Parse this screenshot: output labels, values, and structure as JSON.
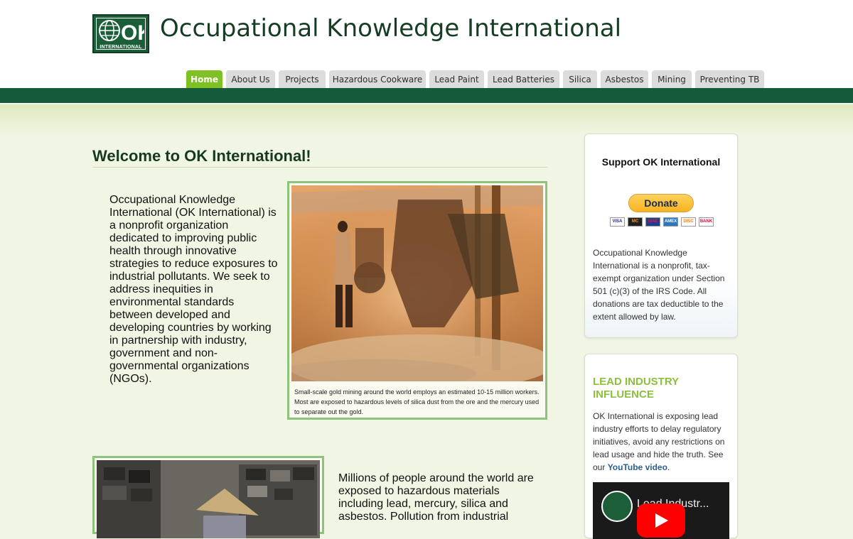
{
  "site": {
    "title": "Occupational Knowledge International",
    "logo_text": "INTERNATIONAL",
    "logo_letters": "OK"
  },
  "nav": {
    "tabs": [
      {
        "label": "Home",
        "active": true
      },
      {
        "label": "About Us"
      },
      {
        "label": "Projects"
      },
      {
        "label": "Hazardous Cookware"
      },
      {
        "label": "Lead Paint"
      },
      {
        "label": "Lead Batteries"
      },
      {
        "label": "Silica"
      },
      {
        "label": "Asbestos"
      },
      {
        "label": "Mining"
      },
      {
        "label": "Preventing TB"
      }
    ]
  },
  "main": {
    "heading": "Welcome to OK International!",
    "intro": "Occupational Knowledge International (OK International) is a nonprofit organization dedicated to improving public health through innovative strategies to reduce exposures to industrial pollutants. We seek to address inequities in environmental standards between developed and developing countries by working in partnership with industry, government and non-governmental organizations (NGOs).",
    "photo_caption": "Small-scale gold mining around the world employs an estimated 10-15 million workers. Most are exposed to hazardous levels of silica dust from the ore and the mercury used to separate out the gold.",
    "paragraph2": "Millions of people around the world are exposed to hazardous materials including lead, mercury, silica and asbestos. Pollution from industrial"
  },
  "sidebar": {
    "support": {
      "title": "Support OK International",
      "donate_label": "Donate",
      "cards": [
        "VISA",
        "MC",
        "MAE",
        "AMEX",
        "DISC",
        "BANK"
      ],
      "text": "Occupational Knowledge International is a nonprofit, tax-exempt organization under Section 501 (c)(3) of the IRS Code. All donations are tax deductible to the extent allowed by law."
    },
    "lead": {
      "title": "LEAD INDUSTRY INFLUENCE",
      "text_before": "OK International is exposing lead industry efforts to delay regulatory initiatives, avoid any restrictions on lead usage and hide the truth. See our ",
      "link_text": "YouTube video",
      "text_after": ".",
      "video_title": "Lead Industr..."
    }
  },
  "colors": {
    "header_bar": "#145c39",
    "active_tab": "#7fc024",
    "accent_green": "#8cbf3c",
    "page_bg": "#f1f5e3"
  }
}
